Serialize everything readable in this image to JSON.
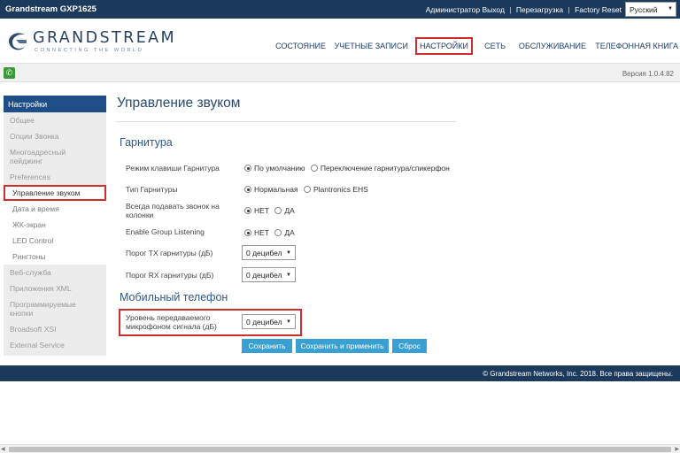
{
  "topbar": {
    "model": "Grandstream GXP1625",
    "admin": "Администратор",
    "logout": "Выход",
    "reboot": "Перезагрузка",
    "factory_reset": "Factory Reset",
    "separator": "|",
    "language": "Русский"
  },
  "logo": {
    "brand": "GRANDSTREAM",
    "tagline": "CONNECTING THE WORLD"
  },
  "nav": [
    {
      "label": "СОСТОЯНИЕ"
    },
    {
      "label": "УЧЕТНЫЕ ЗАПИСИ"
    },
    {
      "label": "НАСТРОЙКИ"
    },
    {
      "label": "СЕТЬ"
    },
    {
      "label": "ОБСЛУЖИВАНИЕ"
    },
    {
      "label": "ТЕЛЕФОННАЯ КНИГА"
    }
  ],
  "status": {
    "version": "Версия 1.0.4.82",
    "phone_glyph": "✆"
  },
  "sidebar": {
    "header": "Настройки",
    "items": [
      "Общее",
      "Опции Звонка",
      "Многоадресный пейджинг",
      "Preferences",
      "Управление звуком",
      "Дата и время",
      "ЖК-экран",
      "LED Control",
      "Рингтоны",
      "Веб-служба",
      "Приложения XML",
      "Программируемые кнопки",
      "Broadsoft XSI",
      "External Service"
    ]
  },
  "page": {
    "title": "Управление звуком",
    "section_headset": "Гарнитура",
    "section_mobile": "Мобильный телефон"
  },
  "rows": {
    "headset_key_mode": {
      "label": "Режим клавиши Гарнитура",
      "opt1": "По умолчанию",
      "opt2": "Переключение гарнитура/спикерфон"
    },
    "headset_type": {
      "label": "Тип Гарнитуры",
      "opt1": "Нормальная",
      "opt2": "Plantronics EHS"
    },
    "always_ring_speaker": {
      "label": "Всегда подавать звонок на колонки",
      "opt1": "НЕТ",
      "opt2": "ДА"
    },
    "group_listening": {
      "label": "Enable Group Listening",
      "opt1": "НЕТ",
      "opt2": "ДА"
    },
    "tx_gain": {
      "label": "Порог TX гарнитуры (дБ)",
      "value": "0 децибел"
    },
    "rx_gain": {
      "label": "Порог RX гарнитуры (дБ)",
      "value": "0 децибел"
    },
    "mic_level": {
      "label": "Уровень передаваемого микрофоном сигнала (дБ)",
      "value": "0 децибел"
    }
  },
  "buttons": {
    "save": "Сохранить",
    "save_apply": "Сохранить и применить",
    "reset": "Сброс"
  },
  "footer": {
    "copyright": "© Grandstream Networks, Inc. 2018. Все права защищены."
  },
  "colors": {
    "topbar": "#1b3a5c",
    "accent": "#1f4e86",
    "button": "#3a9fd1",
    "highlight": "#cc2d2d"
  }
}
